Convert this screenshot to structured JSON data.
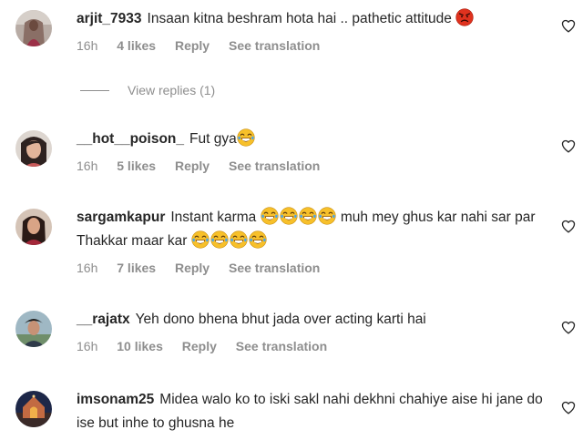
{
  "comments": [
    {
      "username": "arjit_7933",
      "text": "Insaan kitna beshram hota hai .. pathetic attitude",
      "time": "16h",
      "likes": "4 likes",
      "reply": "Reply",
      "translate": "See translation"
    },
    {
      "username": "__hot__poison_",
      "text": "Fut gya",
      "time": "16h",
      "likes": "5 likes",
      "reply": "Reply",
      "translate": "See translation"
    },
    {
      "username": "sargamkapur",
      "text_a": "Instant karma",
      "text_b": "muh mey ghus kar nahi sar par Thakkar maar kar",
      "time": "16h",
      "likes": "7 likes",
      "reply": "Reply",
      "translate": "See translation"
    },
    {
      "username": "__rajatx",
      "text": "Yeh dono bhena bhut jada over acting karti hai",
      "time": "16h",
      "likes": "10 likes",
      "reply": "Reply",
      "translate": "See translation"
    },
    {
      "username": "imsonam25",
      "text": "Midea walo ko to iski sakl nahi dekhni chahiye aise hi jane do ise but inhe to ghusna he"
    }
  ],
  "view_replies": "View replies (1)",
  "icons": {
    "angry": "angry-face-icon",
    "laugh": "tears-of-joy-icon",
    "heart": "heart-outline-icon"
  },
  "colors": {
    "text": "#262626",
    "muted": "#8e8e8e",
    "angry_red": "#e0321e",
    "emoji_yellow": "#f7c02a",
    "tears_blue": "#4aa3e8"
  }
}
